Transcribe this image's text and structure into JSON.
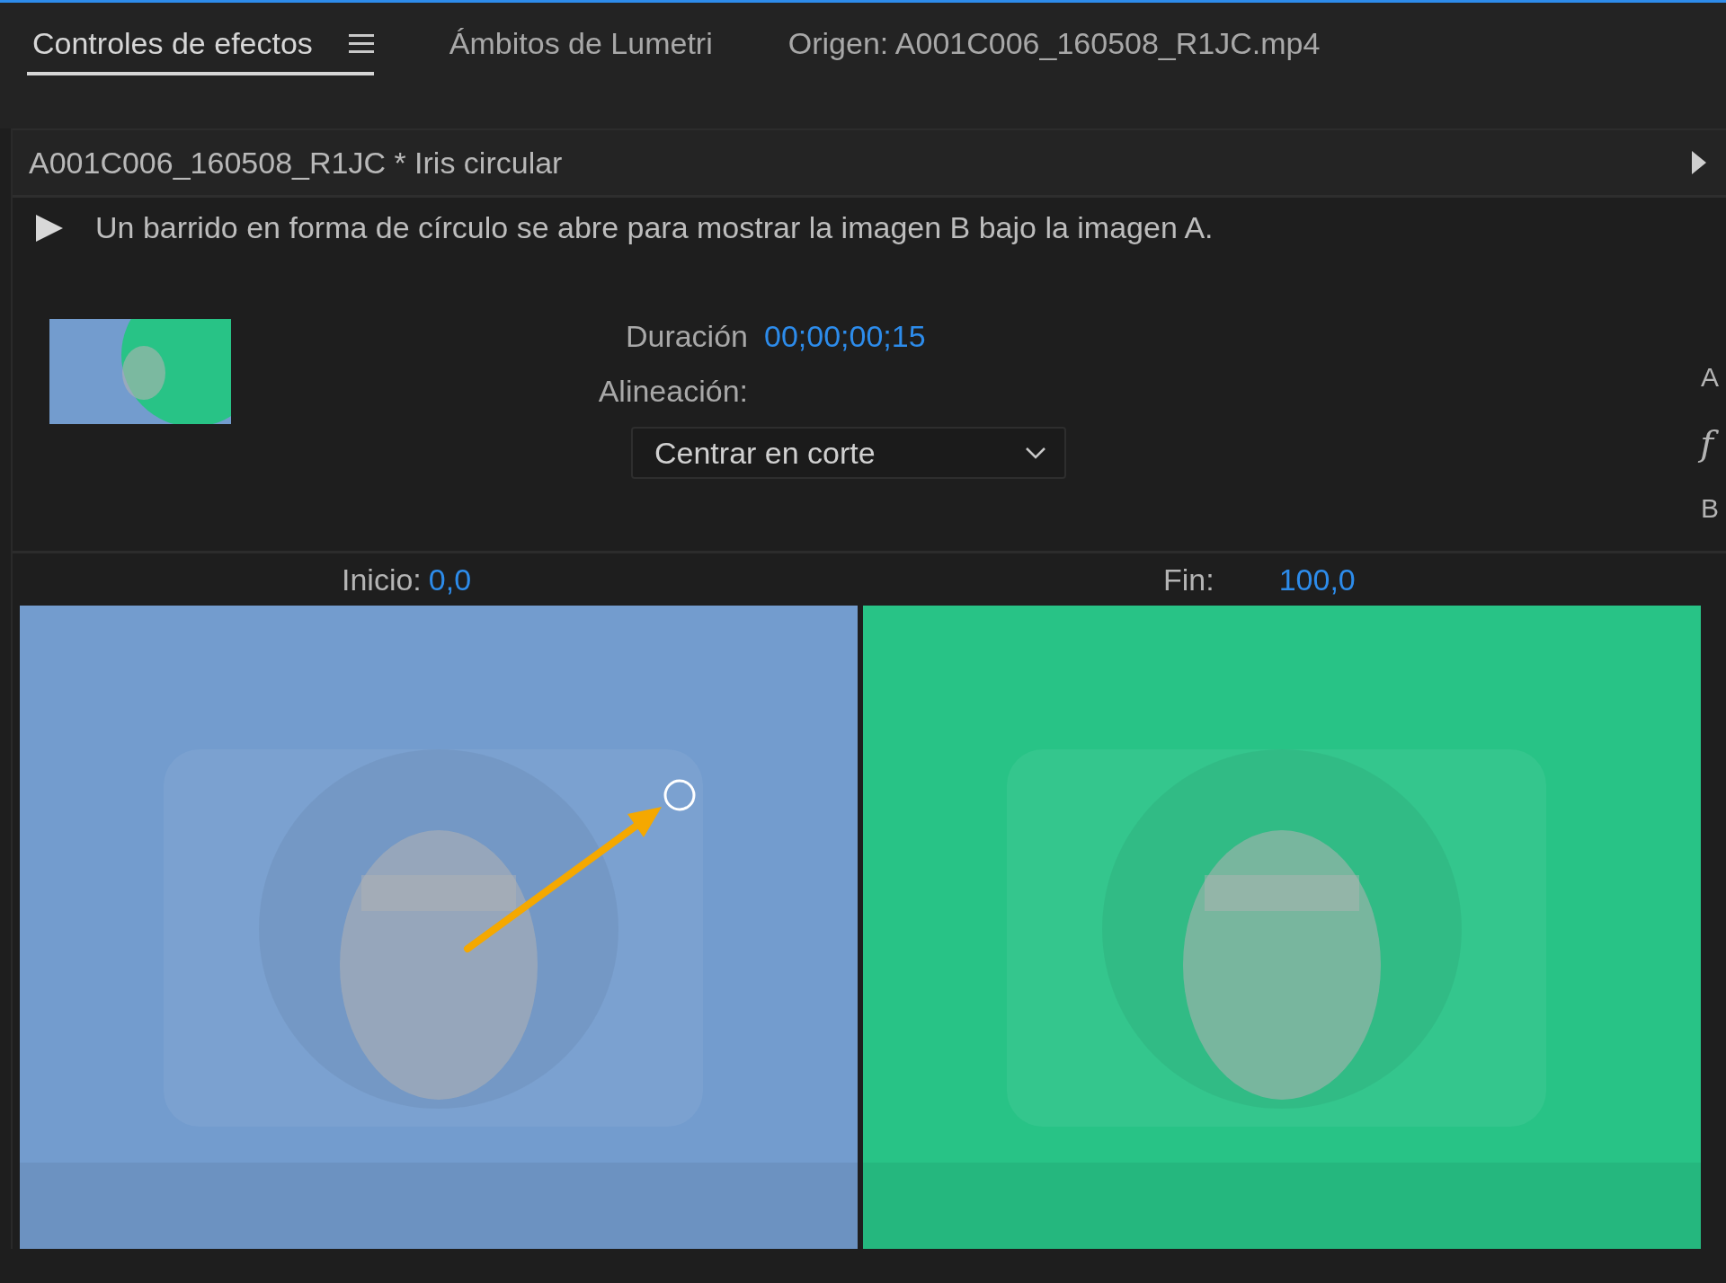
{
  "tabs": [
    {
      "label": "Controles de efectos",
      "selected": true,
      "has_menu": true
    },
    {
      "label": "Ámbitos de Lumetri",
      "selected": false,
      "has_menu": false
    },
    {
      "label": "Origen: A001C006_160508_R1JC.mp4",
      "selected": false,
      "has_menu": false
    }
  ],
  "header": {
    "title": "A001C006_160508_R1JC * Iris circular"
  },
  "description": "Un barrido en forma de círculo se abre para mostrar la imagen B bajo la imagen A.",
  "side_labels": [
    "A",
    "f",
    "B"
  ],
  "duration": {
    "label": "Duración",
    "value": "00;00;00;15"
  },
  "alignment": {
    "label": "Alineación:",
    "value": "Centrar en corte"
  },
  "start": {
    "label": "Inicio:",
    "value": "0,0"
  },
  "end": {
    "label": "Fin:",
    "value": "100,0"
  }
}
